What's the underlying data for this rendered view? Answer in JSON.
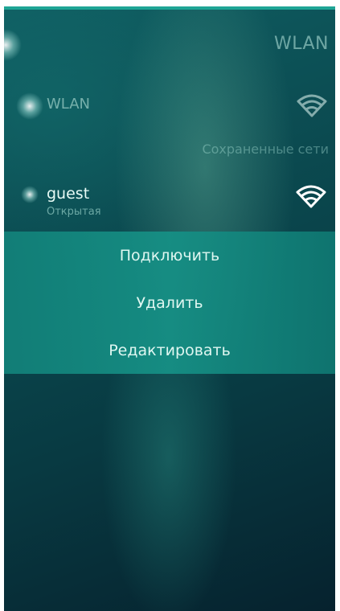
{
  "header": {
    "title": "WLAN"
  },
  "wlan_toggle": {
    "label": "WLAN"
  },
  "saved_section": {
    "title": "Сохраненные сети"
  },
  "network": {
    "name": "guest",
    "security": "Открытая"
  },
  "context_menu": {
    "items": [
      {
        "label": "Подключить"
      },
      {
        "label": "Удалить"
      },
      {
        "label": "Редактировать"
      }
    ]
  },
  "colors": {
    "accent": "#1fa596",
    "menu_background": "#16918a",
    "background": "#0b4a50"
  },
  "icons": [
    "wifi-icon",
    "wifi-icon"
  ]
}
